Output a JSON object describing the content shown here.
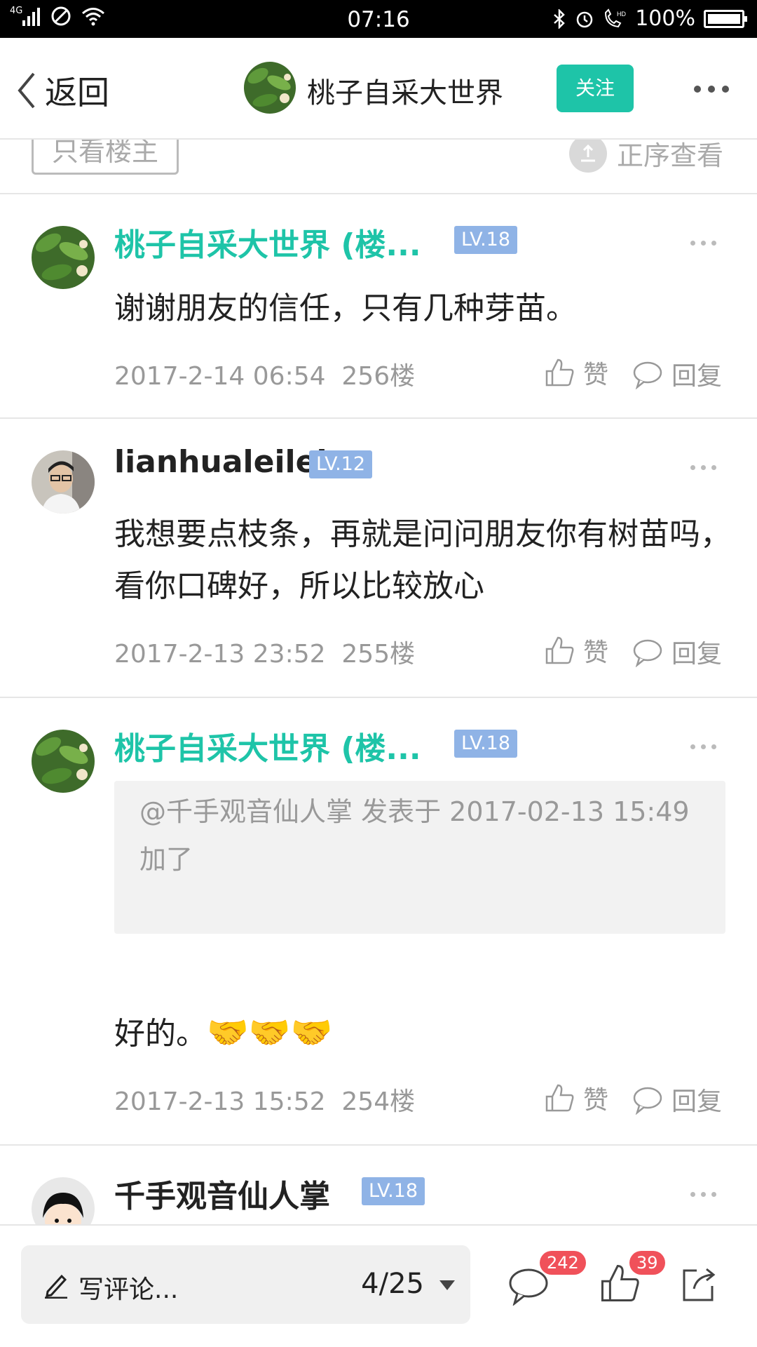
{
  "status_bar": {
    "network": "4G",
    "time": "07:16",
    "battery": "100%",
    "battery_level": 1.0
  },
  "header": {
    "back_label": "返回",
    "title": "桃子自采大世界",
    "follow_label": "关注"
  },
  "filter": {
    "only_op_label": "只看楼主",
    "sort_label": "正序查看"
  },
  "posts": [
    {
      "author": "桃子自采大世界 (楼...",
      "level": "LV.18",
      "content": "谢谢朋友的信任，只有几种芽苗。",
      "datetime": "2017-2-14 06:54",
      "floor": "256楼",
      "like_label": "赞",
      "reply_label": "回复"
    },
    {
      "author": "lianhualeilei",
      "level": "LV.12",
      "content": "我想要点枝条，再就是问问朋友你有树苗吗，看你口碑好，所以比较放心",
      "datetime": "2017-2-13 23:52",
      "floor": "255楼",
      "like_label": "赞",
      "reply_label": "回复"
    },
    {
      "author": "桃子自采大世界 (楼...",
      "level": "LV.18",
      "quote_header": "@千手观音仙人掌 发表于 2017-02-13 15:49",
      "quote_body": "加了",
      "content": "好的。",
      "emoji": "🤝🤝🤝",
      "datetime": "2017-2-13 15:52",
      "floor": "254楼",
      "like_label": "赞",
      "reply_label": "回复"
    },
    {
      "author": "千手观音仙人掌",
      "level": "LV.18"
    }
  ],
  "bottom_bar": {
    "write_placeholder": "写评论...",
    "page_indicator": "4/25",
    "comment_count": "242",
    "like_count": "39"
  },
  "colors": {
    "accent": "#1ec4a8",
    "level_badge": "#8fb3e6",
    "count_badge": "#f0515a"
  }
}
